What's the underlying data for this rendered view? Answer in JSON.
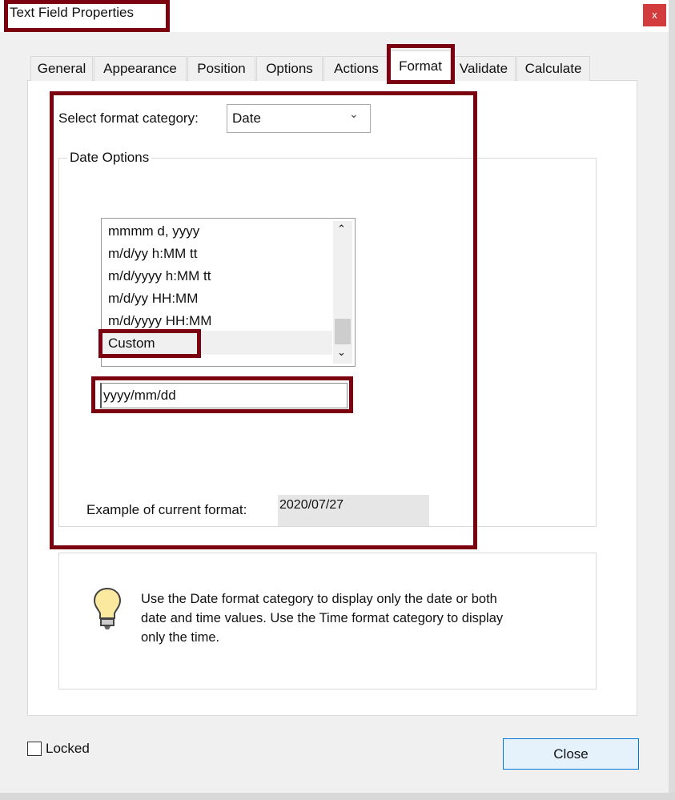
{
  "window": {
    "title": "Text Field Properties",
    "close_glyph": "x"
  },
  "tabs": [
    {
      "label": "General"
    },
    {
      "label": "Appearance"
    },
    {
      "label": "Position"
    },
    {
      "label": "Options"
    },
    {
      "label": "Actions"
    },
    {
      "label": "Format",
      "active": true
    },
    {
      "label": "Validate"
    },
    {
      "label": "Calculate"
    }
  ],
  "format": {
    "category_label": "Select format category:",
    "category_value": "Date",
    "group_label": "Date Options",
    "options": [
      "mmmm d, yyyy",
      "m/d/yy h:MM tt",
      "m/d/yyyy h:MM tt",
      "m/d/yy HH:MM",
      "m/d/yyyy HH:MM",
      "Custom"
    ],
    "selected": "Custom",
    "custom_value": "yyyy/mm/dd",
    "example_label": "Example of current format:",
    "example_value": "2020/07/27"
  },
  "hint": {
    "icon": "lightbulb-icon",
    "text": "Use the Date format category to display only the date or both date and time values. Use the Time format category to display only the time."
  },
  "footer": {
    "locked_label": "Locked",
    "locked_checked": false,
    "close_label": "Close"
  },
  "colors": {
    "annotation": "#7b0010",
    "close_red": "#d33c3c",
    "button_accent": "#0078d7"
  }
}
